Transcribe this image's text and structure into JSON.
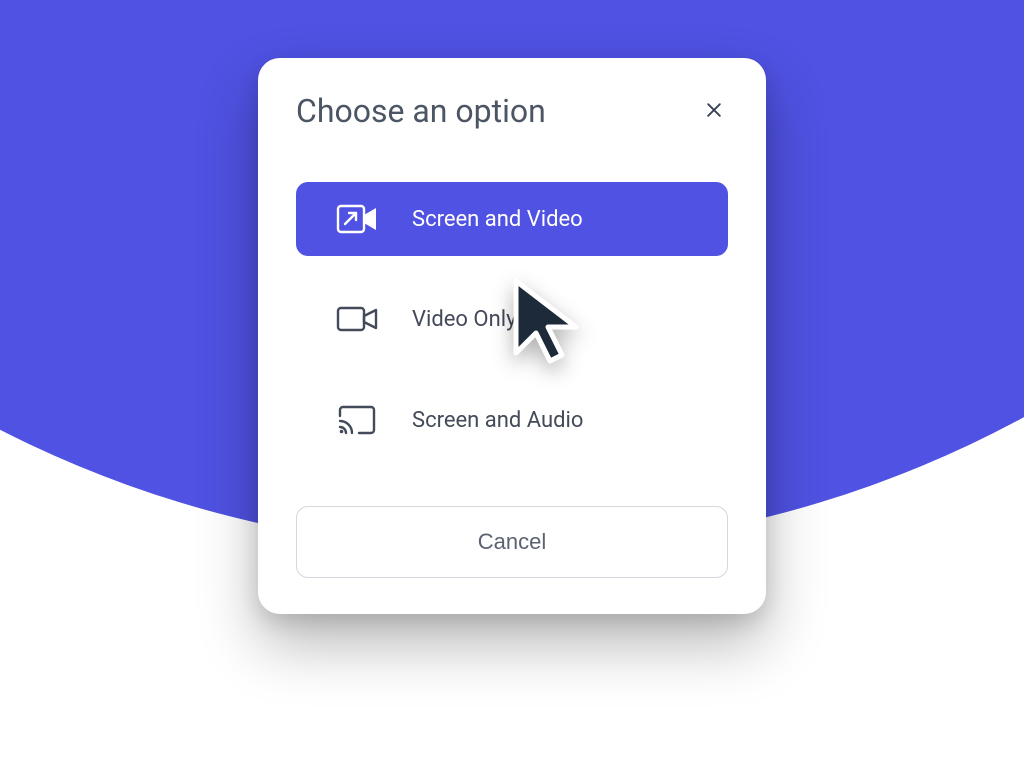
{
  "modal": {
    "title": "Choose an option",
    "options": [
      {
        "label": "Screen and Video"
      },
      {
        "label": "Video Only"
      },
      {
        "label": "Screen and Audio"
      }
    ],
    "cancel_label": "Cancel"
  }
}
